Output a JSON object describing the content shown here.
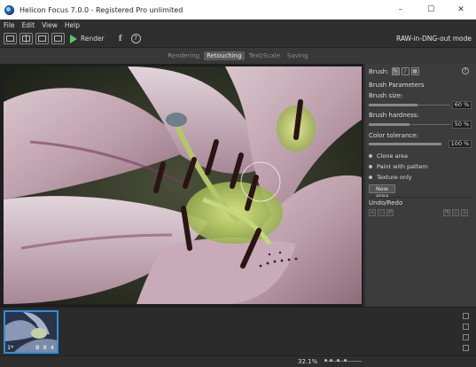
{
  "window": {
    "title": "Helicon Focus 7.0.0 - Registered Pro unlimited",
    "controls": [
      "–",
      "☐",
      "✕"
    ]
  },
  "menu": [
    "File",
    "Edit",
    "View",
    "Help"
  ],
  "toolbar": {
    "render_label": "Render",
    "mode_label": "RAW-in-DNG-out mode",
    "help_glyph": "?",
    "facebook_glyph": "f"
  },
  "tabs": [
    {
      "label": "Rendering",
      "active": false
    },
    {
      "label": "Retouching",
      "active": true
    },
    {
      "label": "Text/Scale",
      "active": false
    },
    {
      "label": "Saving",
      "active": false
    }
  ],
  "panel": {
    "brush_label": "Brush:",
    "help_glyph": "?",
    "brush_parameters": "Brush Parameters",
    "brush_size_label": "Brush size:",
    "brush_size_value": "60 %",
    "brush_size": 0.6,
    "brush_hardness_label": "Brush hardness:",
    "brush_hardness_value": "50 %",
    "brush_hardness": 0.5,
    "color_tolerance_label": "Color tolerance:",
    "color_tolerance_value": "100 %",
    "color_tolerance": 1.0,
    "options": [
      "Clone area",
      "Paint with pattern",
      "Texture only"
    ],
    "new_area_label": "New area",
    "undo_redo_label": "Undo/Redo"
  },
  "filmstrip": {
    "items": [
      {
        "index": "1*",
        "tag": "B 8 4"
      }
    ]
  },
  "status": {
    "zoom": "32.1%"
  },
  "colors": {
    "accent": "#2f8fdc",
    "render_green": "#5cc86a"
  }
}
